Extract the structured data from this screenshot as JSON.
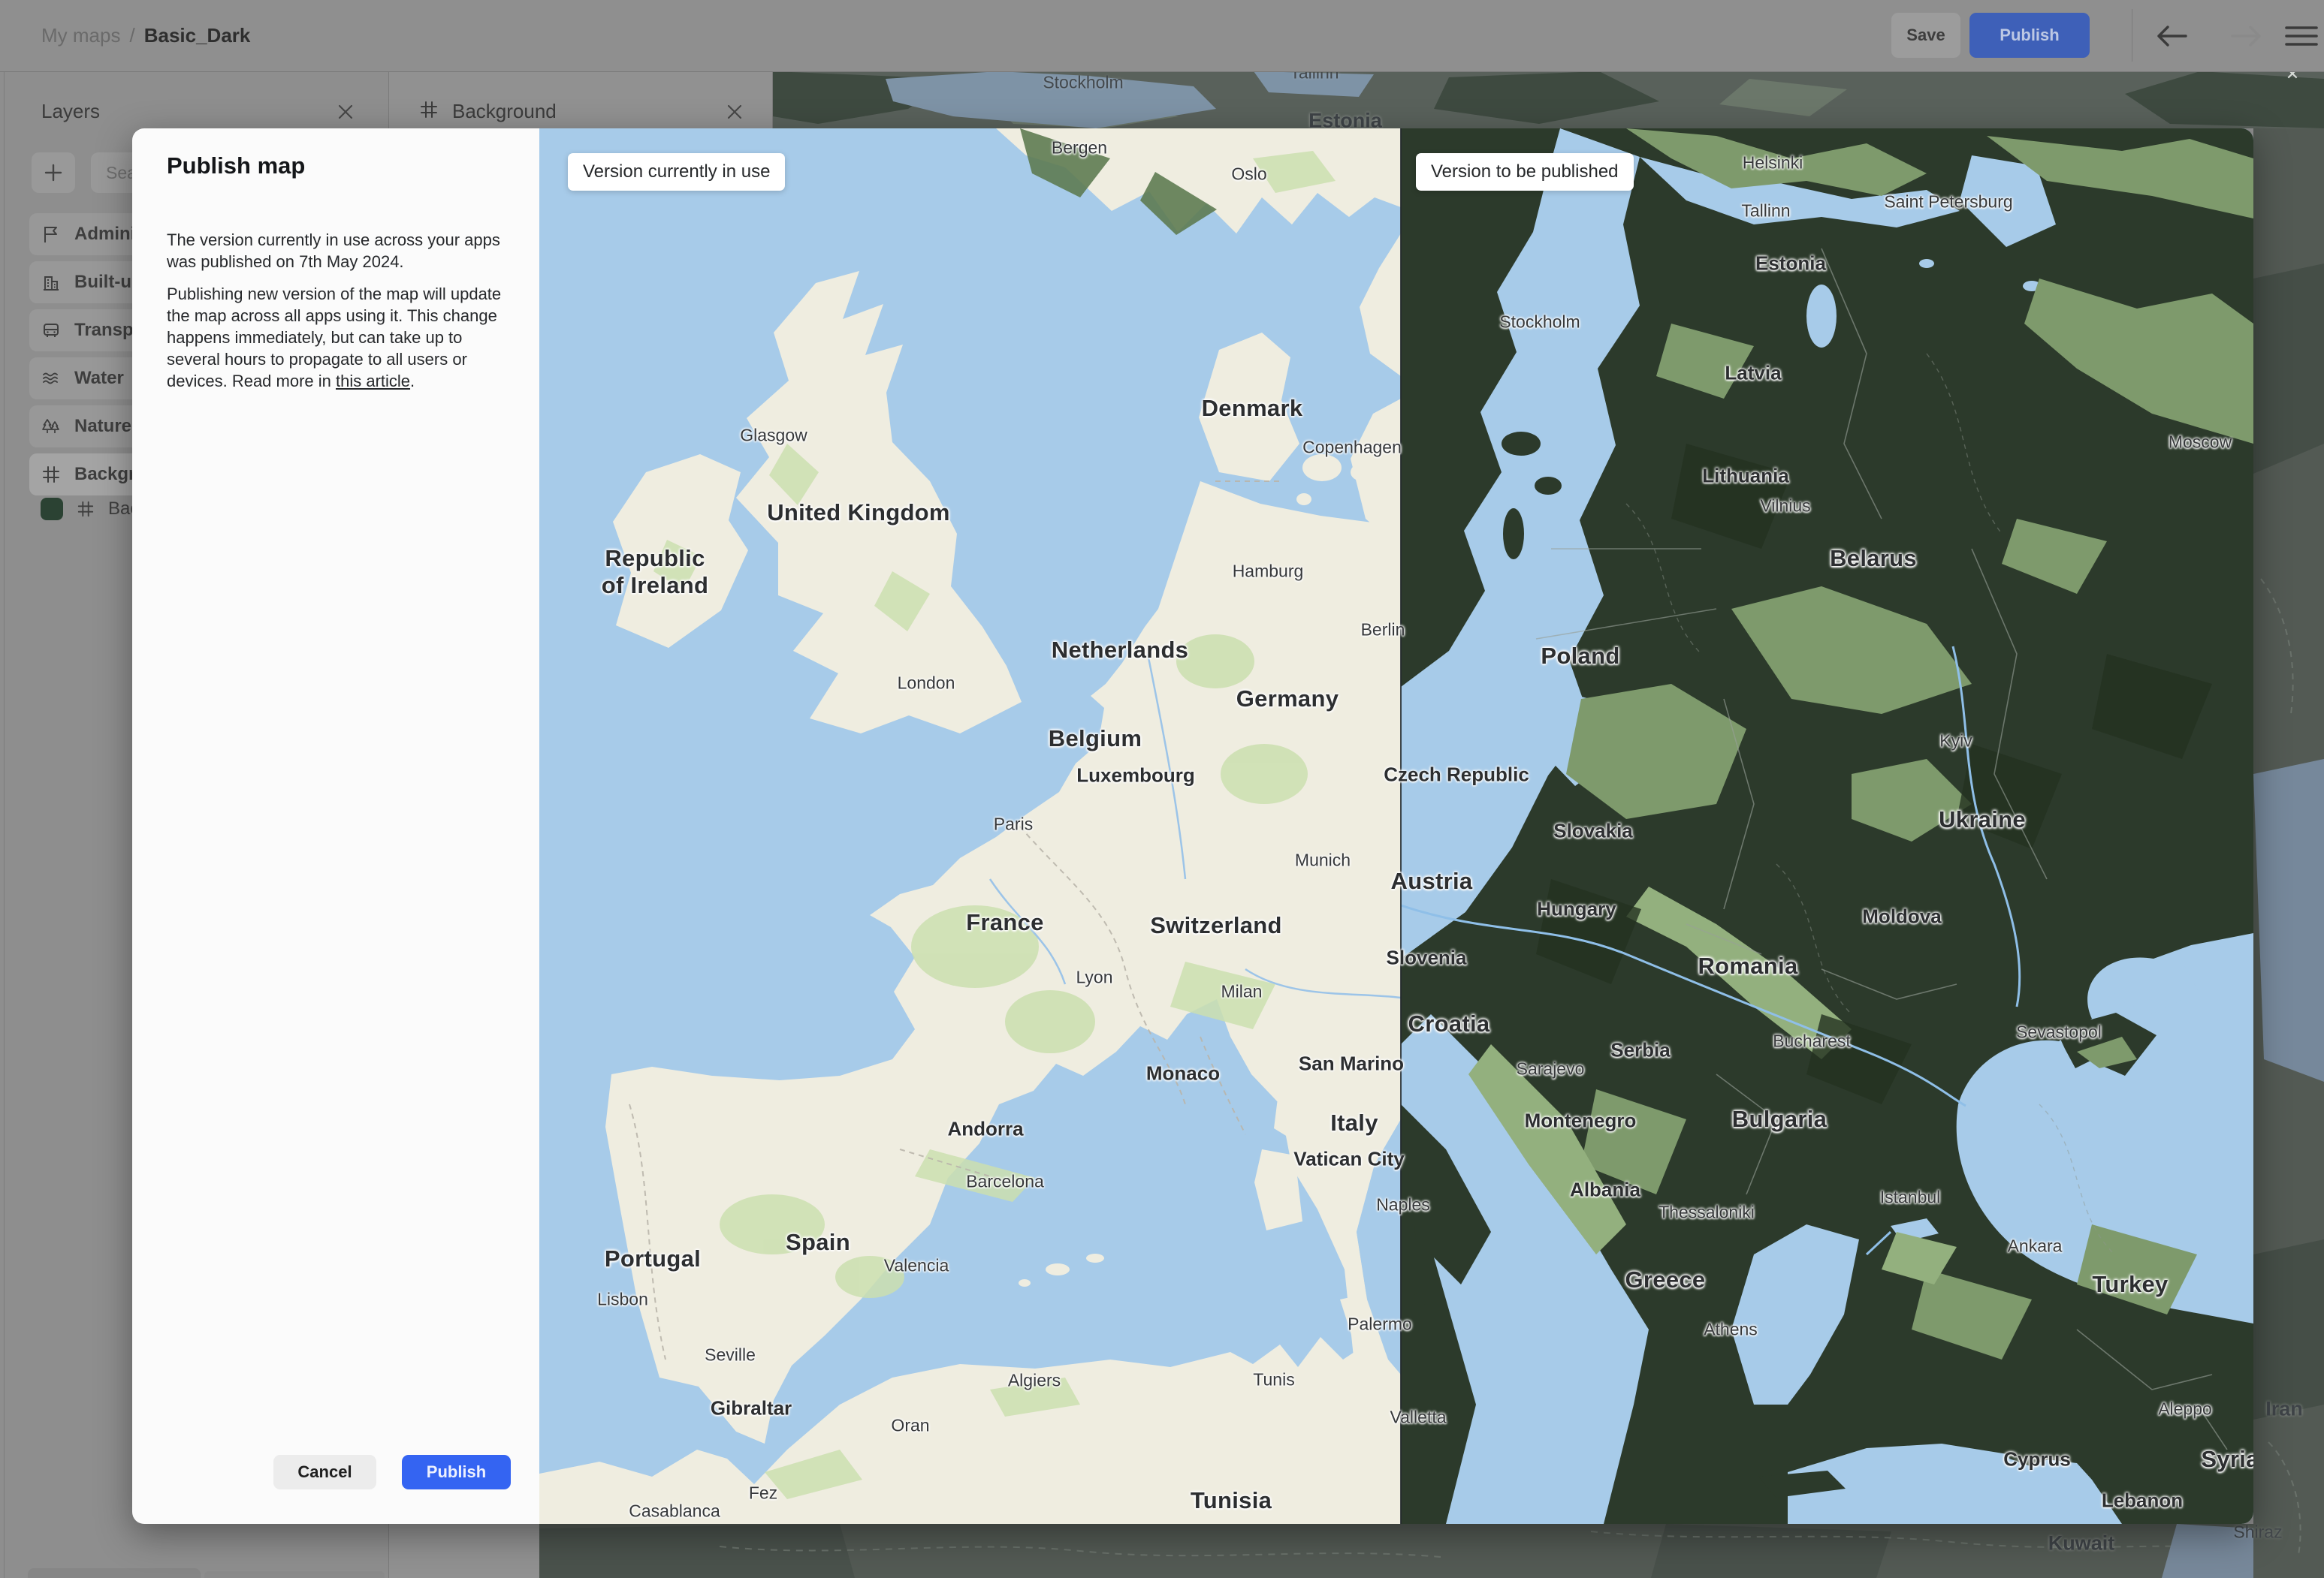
{
  "topbar": {
    "breadcrumb_section": "My maps",
    "breadcrumb_separator": "/",
    "breadcrumb_name": "Basic_Dark",
    "save_label": "Save",
    "publish_label": "Publish",
    "icons": [
      "back-arrow-icon",
      "forward-arrow-icon",
      "menu-icon"
    ]
  },
  "layers_panel": {
    "title": "Layers",
    "add_button_icon": "plus-icon",
    "search_placeholder": "Sea",
    "items": [
      {
        "label": "Adminis",
        "icon": "flag-icon"
      },
      {
        "label": "Built-up",
        "icon": "building-icon"
      },
      {
        "label": "Transpo",
        "icon": "bus-icon"
      },
      {
        "label": "Water",
        "icon": "waves-icon"
      },
      {
        "label": "Nature",
        "icon": "trees-icon"
      },
      {
        "label": "Backgro",
        "icon": "grid-icon"
      }
    ],
    "sublayer": {
      "label": "Bac",
      "icon": "grid-icon",
      "swatch_color": "#2B4233"
    }
  },
  "background_panel": {
    "title": "Background",
    "icon": "grid-icon"
  },
  "publish_dialog": {
    "title": "Publish map",
    "paragraph1": "The version currently in use across your apps was published on 7th May 2024.",
    "paragraph2_before": "Publishing new version of the map will update the map across all apps using it. This change happens immediately, but can take up to several hours to propagate to all users or devices. Read more in ",
    "paragraph2_link": "this article",
    "paragraph2_after": ".",
    "cancel_label": "Cancel",
    "publish_label": "Publish"
  },
  "map_compare": {
    "left_badge": "Version currently in use",
    "right_badge": "Version to be published",
    "labels": [
      [
        "Bergen",
        719,
        26,
        "c"
      ],
      [
        "Oslo",
        945,
        61,
        "c"
      ],
      [
        "Glasgow",
        312,
        409,
        "c"
      ],
      [
        "United Kingdom",
        425,
        512,
        "b"
      ],
      [
        "Republic\nof Ireland",
        154,
        591,
        "b"
      ],
      [
        "London",
        515,
        739,
        "c"
      ],
      [
        "Denmark",
        949,
        373,
        "b"
      ],
      [
        "Copenhagen",
        1082,
        425,
        "c"
      ],
      [
        "Hamburg",
        970,
        590,
        "c"
      ],
      [
        "Netherlands",
        773,
        695,
        "b"
      ],
      [
        "Berlin",
        1123,
        668,
        "c"
      ],
      [
        "Germany",
        996,
        760,
        "b"
      ],
      [
        "Belgium",
        740,
        813,
        "b"
      ],
      [
        "Luxembourg",
        794,
        862,
        "n"
      ],
      [
        "Paris",
        631,
        927,
        "c"
      ],
      [
        "Munich",
        1043,
        975,
        "c"
      ],
      [
        "France",
        620,
        1058,
        "b"
      ],
      [
        "Switzerland",
        901,
        1062,
        "b"
      ],
      [
        "Lyon",
        739,
        1131,
        "c"
      ],
      [
        "Milan",
        935,
        1150,
        "c"
      ],
      [
        "Monaco",
        857,
        1259,
        "n"
      ],
      [
        "San Marino",
        1081,
        1246,
        "n"
      ],
      [
        "Italy",
        1085,
        1325,
        "b"
      ],
      [
        "Vatican City",
        1078,
        1373,
        "n"
      ],
      [
        "Naples",
        1150,
        1434,
        "c"
      ],
      [
        "Andorra",
        594,
        1333,
        "n"
      ],
      [
        "Barcelona",
        620,
        1403,
        "c"
      ],
      [
        "Spain",
        371,
        1484,
        "b"
      ],
      [
        "Valencia",
        502,
        1515,
        "c"
      ],
      [
        "Portugal",
        151,
        1506,
        "b"
      ],
      [
        "Lisbon",
        111,
        1560,
        "c"
      ],
      [
        "Seville",
        254,
        1634,
        "c"
      ],
      [
        "Gibraltar",
        282,
        1705,
        "n"
      ],
      [
        "Oran",
        494,
        1728,
        "c"
      ],
      [
        "Algiers",
        659,
        1668,
        "c"
      ],
      [
        "Tunis",
        978,
        1667,
        "c"
      ],
      [
        "Tunisia",
        921,
        1828,
        "b"
      ],
      [
        "Fez",
        298,
        1818,
        "c"
      ],
      [
        "Casablanca",
        180,
        1842,
        "c"
      ],
      [
        "Palermo",
        1119,
        1593,
        "c"
      ],
      [
        "Helsinki",
        1642,
        46,
        "c"
      ],
      [
        "Saint Petersburg",
        1876,
        98,
        "c"
      ],
      [
        "Tallinn",
        1633,
        110,
        "c"
      ],
      [
        "Stockholm",
        1332,
        258,
        "c"
      ],
      [
        "Estonia",
        1666,
        180,
        "n"
      ],
      [
        "Latvia",
        1616,
        326,
        "n"
      ],
      [
        "Moscow",
        2211,
        418,
        "c"
      ],
      [
        "Lithuania",
        1606,
        463,
        "n"
      ],
      [
        "Vilnius",
        1659,
        503,
        "c"
      ],
      [
        "Belarus",
        1776,
        573,
        "b"
      ],
      [
        "Poland",
        1386,
        703,
        "b"
      ],
      [
        "Kyiv",
        1886,
        816,
        "c"
      ],
      [
        "Czech Republic",
        1221,
        861,
        "n"
      ],
      [
        "Ukraine",
        1921,
        921,
        "b"
      ],
      [
        "Slovakia",
        1403,
        936,
        "n"
      ],
      [
        "Austria",
        1188,
        1003,
        "b"
      ],
      [
        "Hungary",
        1381,
        1040,
        "n"
      ],
      [
        "Moldova",
        1814,
        1050,
        "n"
      ],
      [
        "Slovenia",
        1181,
        1105,
        "n"
      ],
      [
        "Romania",
        1609,
        1116,
        "b"
      ],
      [
        "Croatia",
        1211,
        1193,
        "b"
      ],
      [
        "Serbia",
        1466,
        1228,
        "n"
      ],
      [
        "Sarajevo",
        1346,
        1253,
        "c"
      ],
      [
        "Bucharest",
        1694,
        1216,
        "c"
      ],
      [
        "Sevastopol",
        2023,
        1204,
        "c"
      ],
      [
        "Montenegro",
        1386,
        1322,
        "n"
      ],
      [
        "Bulgaria",
        1651,
        1320,
        "b"
      ],
      [
        "Albania",
        1419,
        1414,
        "n"
      ],
      [
        "Thessaloniki",
        1554,
        1444,
        "c"
      ],
      [
        "Istanbul",
        1825,
        1424,
        "c"
      ],
      [
        "Ankara",
        1991,
        1489,
        "c"
      ],
      [
        "Turkey",
        2118,
        1540,
        "b"
      ],
      [
        "Greece",
        1499,
        1534,
        "b"
      ],
      [
        "Athens",
        1586,
        1600,
        "c"
      ],
      [
        "Cyprus",
        1994,
        1773,
        "n"
      ],
      [
        "Aleppo",
        2191,
        1706,
        "c"
      ],
      [
        "Syria",
        2251,
        1773,
        "b"
      ],
      [
        "Lebanon",
        2134,
        1828,
        "n"
      ],
      [
        "Valletta",
        1170,
        1717,
        "c"
      ]
    ]
  },
  "dimmed_map_labels": [
    [
      "Stockholm",
      1442,
      110,
      "dc"
    ],
    [
      "Tallinn",
      1750,
      97,
      "dc"
    ],
    [
      "Estonia",
      1791,
      161,
      "dn"
    ],
    [
      "Iran",
      3041,
      1877,
      "dn"
    ],
    [
      "Shiraz",
      3006,
      2041,
      "dc"
    ],
    [
      "Kuwait",
      2771,
      2056,
      "dn"
    ],
    [
      "✕",
      3052,
      99,
      "dx"
    ]
  ],
  "colors": {
    "accent_blue": "#3464F2",
    "topbar_publish_dimmed": "#3E60B8",
    "map_sea": "#A7CBE9",
    "map_land_light": "#EFEDE0",
    "map_land_dark": "#2C3A2B",
    "map_green_light": "#CBDFAF",
    "map_green_dark": "#7E9A6C",
    "sublayer_swatch": "#2B4233"
  }
}
